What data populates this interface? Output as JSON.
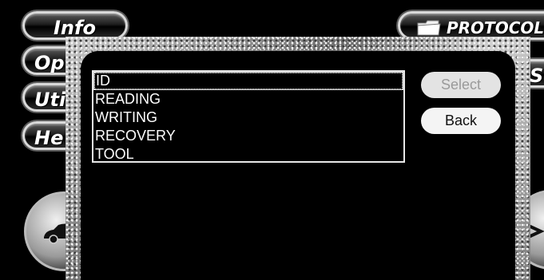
{
  "background": {
    "menu": {
      "info": "Info",
      "options_partial": "Opt",
      "utilities_partial": "Uti",
      "help_partial": "He",
      "protocols": "PROTOCOLS",
      "right_partial": "S"
    },
    "icons": {
      "folder": "folder-icon",
      "car": "car-icon",
      "arrow": "chevron-right-icon"
    }
  },
  "dialog": {
    "list": {
      "items": [
        "ID",
        "READING",
        "WRITING",
        "RECOVERY",
        "TOOL"
      ],
      "selected_index": 0
    },
    "buttons": {
      "select_label": "Select",
      "select_enabled": false,
      "back_label": "Back"
    }
  },
  "colors": {
    "background": "#000000",
    "list_text": "#ffffff",
    "button_bg": "#f4f4f4",
    "button_disabled_text": "#9a9a9a"
  }
}
